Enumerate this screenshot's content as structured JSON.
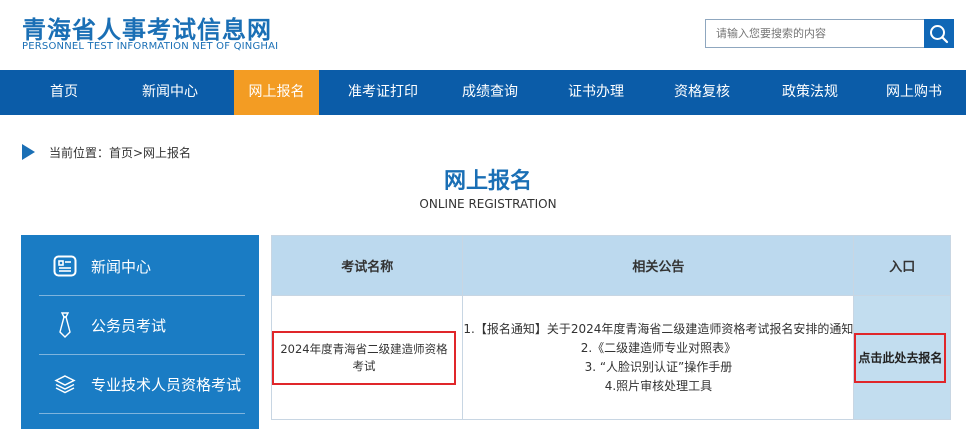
{
  "header": {
    "title": "青海省人事考试信息网",
    "subtitle": "PERSONNEL TEST INFORMATION NET OF QINGHAI",
    "search_placeholder": "请输入您要搜索的内容"
  },
  "nav": {
    "items": [
      "首页",
      "新闻中心",
      "网上报名",
      "准考证打印",
      "成绩查询",
      "证书办理",
      "资格复核",
      "政策法规",
      "网上购书"
    ],
    "active_index": 2
  },
  "breadcrumb": "当前位置：首页>网上报名",
  "page": {
    "title": "网上报名",
    "subtitle": "ONLINE REGISTRATION"
  },
  "sidebar": {
    "items": [
      {
        "label": "新闻中心",
        "icon": "news-icon"
      },
      {
        "label": "公务员考试",
        "icon": "tie-icon"
      },
      {
        "label": "专业技术人员资格考试",
        "icon": "layers-icon"
      }
    ]
  },
  "table": {
    "headers": [
      "考试名称",
      "相关公告",
      "入口"
    ],
    "rows": [
      {
        "name": "2024年度青海省二级建造师资格考试",
        "notices": [
          "1.【报名通知】关于2024年度青海省二级建造师资格考试报名安排的通知",
          "2.《二级建造师专业对照表》",
          "3. “人脸识别认证”操作手册",
          "4.照片审核处理工具"
        ],
        "entry": "点击此处去报名"
      }
    ]
  },
  "colors": {
    "brand_blue": "#1a6fb5",
    "nav_blue": "#0b5ca8",
    "active_orange": "#f39c23",
    "sidebar_blue": "#1a7cc4",
    "highlight_red": "#e0262a"
  }
}
